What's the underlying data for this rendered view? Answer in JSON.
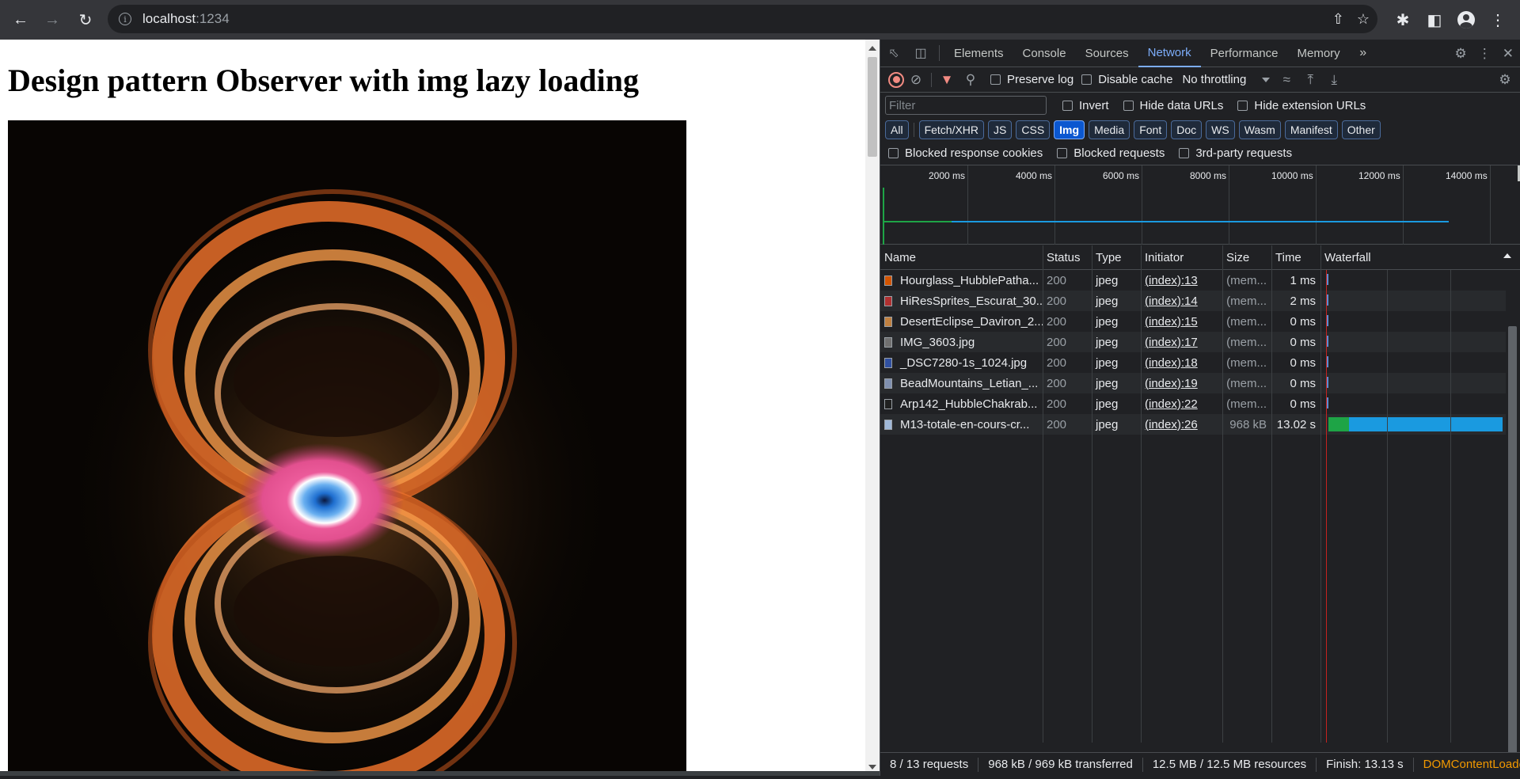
{
  "browser": {
    "url_host": "localhost",
    "url_port": ":1234"
  },
  "page": {
    "heading": "Design pattern Observer with img lazy loading"
  },
  "devtools": {
    "tabs": [
      "Elements",
      "Console",
      "Sources",
      "Network",
      "Performance",
      "Memory"
    ],
    "active_tab": "Network",
    "toolbar": {
      "preserve_log": "Preserve log",
      "disable_cache": "Disable cache",
      "throttling": "No throttling"
    },
    "filter": {
      "placeholder": "Filter",
      "invert": "Invert",
      "hide_data_urls": "Hide data URLs",
      "hide_extension_urls": "Hide extension URLs"
    },
    "type_filters": [
      "All",
      "Fetch/XHR",
      "JS",
      "CSS",
      "Img",
      "Media",
      "Font",
      "Doc",
      "WS",
      "Wasm",
      "Manifest",
      "Other"
    ],
    "active_type": "Img",
    "blocked": {
      "blocked_response_cookies": "Blocked response cookies",
      "blocked_requests": "Blocked requests",
      "third_party_requests": "3rd-party requests"
    },
    "overview_ticks": [
      "2000 ms",
      "4000 ms",
      "6000 ms",
      "8000 ms",
      "10000 ms",
      "12000 ms",
      "14000 ms"
    ],
    "columns": [
      "Name",
      "Status",
      "Type",
      "Initiator",
      "Size",
      "Time",
      "Waterfall"
    ],
    "requests": [
      {
        "name": "Hourglass_HubblePatha...",
        "status": "200",
        "type": "jpeg",
        "initiator": "(index):13",
        "size": "(mem...",
        "time": "1 ms",
        "icon_color": "#d35400"
      },
      {
        "name": "HiResSprites_Escurat_30...",
        "status": "200",
        "type": "jpeg",
        "initiator": "(index):14",
        "size": "(mem...",
        "time": "2 ms",
        "icon_color": "#b03030"
      },
      {
        "name": "DesertEclipse_Daviron_2...",
        "status": "200",
        "type": "jpeg",
        "initiator": "(index):15",
        "size": "(mem...",
        "time": "0 ms",
        "icon_color": "#c08040"
      },
      {
        "name": "IMG_3603.jpg",
        "status": "200",
        "type": "jpeg",
        "initiator": "(index):17",
        "size": "(mem...",
        "time": "0 ms",
        "icon_color": "#707070"
      },
      {
        "name": "_DSC7280-1s_1024.jpg",
        "status": "200",
        "type": "jpeg",
        "initiator": "(index):18",
        "size": "(mem...",
        "time": "0 ms",
        "icon_color": "#3050a0"
      },
      {
        "name": "BeadMountains_Letian_...",
        "status": "200",
        "type": "jpeg",
        "initiator": "(index):19",
        "size": "(mem...",
        "time": "0 ms",
        "icon_color": "#8090b0"
      },
      {
        "name": "Arp142_HubbleChakrab...",
        "status": "200",
        "type": "jpeg",
        "initiator": "(index):22",
        "size": "(mem...",
        "time": "0 ms",
        "icon_color": "#202020"
      },
      {
        "name": "M13-totale-en-cours-cr...",
        "status": "200",
        "type": "jpeg",
        "initiator": "(index):26",
        "size": "968 kB",
        "time": "13.02 s",
        "icon_color": "#a0b8d8"
      }
    ],
    "status_bar": {
      "requests": "8 / 13 requests",
      "transferred": "968 kB / 969 kB transferred",
      "resources": "12.5 MB / 12.5 MB resources",
      "finish": "Finish: 13.13 s",
      "dcl": "DOMContentLoaded:"
    }
  },
  "colors": {
    "accent": "#7cacf8",
    "waiting_green": "#1ea446",
    "download_blue": "#1a9ae0"
  }
}
